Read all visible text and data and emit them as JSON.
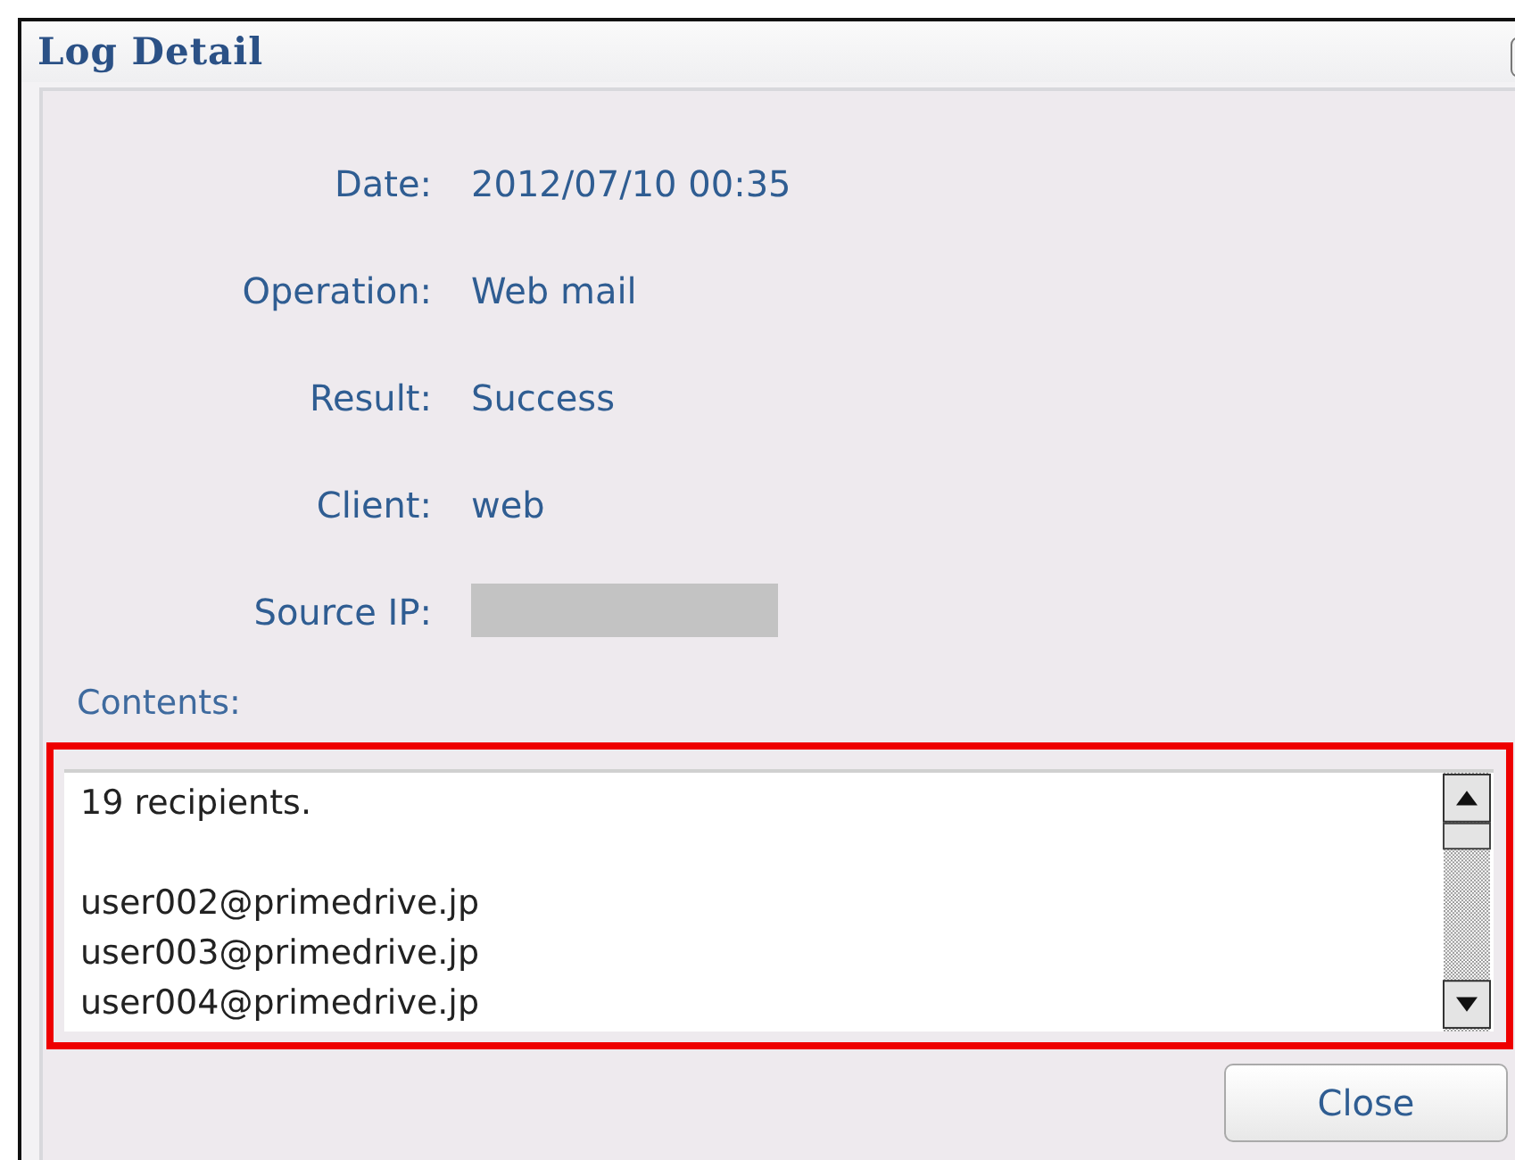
{
  "window": {
    "title": "Log Detail"
  },
  "fields": [
    {
      "label": "Date:",
      "kind": "text",
      "value": "2012/07/10 00:35"
    },
    {
      "label": "Operation:",
      "kind": "text",
      "value": "Web mail"
    },
    {
      "label": "Result:",
      "kind": "text",
      "value": "Success"
    },
    {
      "label": "Client:",
      "kind": "text",
      "value": "web"
    },
    {
      "label": "Source IP:",
      "kind": "redacted"
    }
  ],
  "contents": {
    "label": "Contents:",
    "highlighted": true,
    "paragraphs": [
      [
        "19 recipients."
      ],
      [
        "user002@primedrive.jp",
        "user003@primedrive.jp",
        "user004@primedrive.jp"
      ]
    ]
  },
  "buttons": [
    "Close"
  ]
}
